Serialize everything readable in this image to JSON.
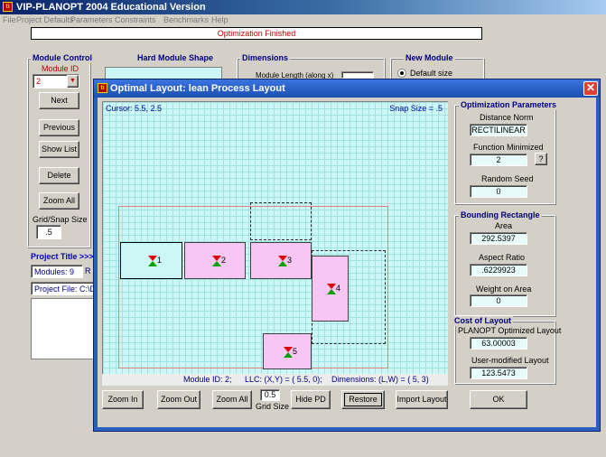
{
  "app": {
    "title": "VIP-PLANOPT 2004 Educational Version",
    "menu": [
      "File",
      "Project Defaults",
      "Parameters",
      "Constraints",
      "Benchmarks",
      "Help"
    ],
    "status": "Optimization Finished"
  },
  "module_control": {
    "label": "Module Control",
    "module_id_label": "Module ID",
    "module_id_value": "2",
    "buttons": {
      "next": "Next",
      "previous": "Previous",
      "show_list": "Show List",
      "delete": "Delete",
      "zoom_all": "Zoom All"
    },
    "grid_snap_label": "Grid/Snap Size",
    "grid_snap_value": ".5"
  },
  "hard_module_shape": {
    "label": "Hard Module Shape"
  },
  "dimensions": {
    "label": "Dimensions",
    "length_label": "Module Length (along x)"
  },
  "new_module": {
    "label": "New Module",
    "default_size": "Default size"
  },
  "project": {
    "title_label": "Project  Title >>>",
    "modules_text": "Modules:  9",
    "r_text": "R",
    "file_text": "Project File:  C:\\Doc"
  },
  "dialog": {
    "title": "Optimal Layout:   lean Process Layout",
    "close_glyph": "✕",
    "cursor_text": "Cursor:  5.5,  2.5",
    "snap_text": "Snap Size =  .5",
    "modules": [
      {
        "num": "1",
        "selected": false
      },
      {
        "num": "2",
        "selected": true
      },
      {
        "num": "3",
        "selected": false
      },
      {
        "num": "4",
        "selected": false
      },
      {
        "num": "5",
        "selected": false
      }
    ],
    "info": {
      "module_id": "Module ID:  2;",
      "llc": "LLC: (X,Y) = ( 5.5, 0);",
      "dims": "Dimensions: (L,W) = ( 5, 3)"
    },
    "buttons": {
      "zoom_in": "Zoom In",
      "zoom_out": "Zoom Out",
      "zoom_all": "Zoom All",
      "hide_pd": "Hide PD",
      "restore": "Restore",
      "import_layout": "Import Layout",
      "ok": "OK",
      "help": "?"
    },
    "grid_size_value": "0.5",
    "grid_size_label": "Grid Size",
    "opt_params": {
      "label": "Optimization Parameters",
      "distance_norm_label": "Distance Norm",
      "distance_norm_value": "RECTILINEAR",
      "function_label": "Function Minimized",
      "function_value": "2",
      "seed_label": "Random Seed",
      "seed_value": "0"
    },
    "bounding": {
      "label": "Bounding Rectangle",
      "area_label": "Area",
      "area_value": "292.5397",
      "aspect_label": "Aspect Ratio",
      "aspect_value": ".6229923",
      "weight_label": "Weight on Area",
      "weight_value": "0"
    },
    "cost": {
      "label": "Cost of Layout",
      "planopt_label": "PLANOPT Optimized Layout",
      "planopt_value": "63.00003",
      "user_label": "User-modified Layout",
      "user_value": "123.5473"
    }
  },
  "colors": {
    "module_fill": "#f7c6f2",
    "canvas_bg": "#cdf7f7",
    "title_blue": "#0a246a",
    "label_blue": "#000080",
    "marker_red": "#e00000",
    "marker_green": "#00a000"
  }
}
